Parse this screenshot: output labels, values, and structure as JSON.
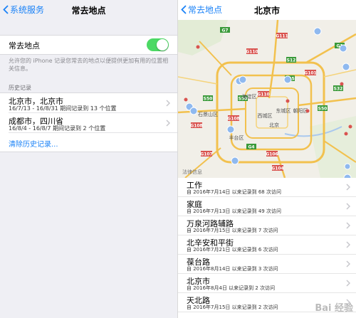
{
  "left": {
    "back_label": "系统服务",
    "title": "常去地点",
    "toggle": {
      "label": "常去地点",
      "on": true
    },
    "description": "允许您的 iPhone 记录您常去的地点以便提供更加有用的位置相关信息。",
    "history_header": "历史记录",
    "history": [
      {
        "title": "北京市，北京市",
        "subtitle": "16/7/13 - 16/8/31 期间记录到 13 个位置"
      },
      {
        "title": "成都市，四川省",
        "subtitle": "16/8/4 - 16/8/7 期间记录到 2 个位置"
      }
    ],
    "clear_label": "清除历史记录..."
  },
  "right": {
    "back_label": "常去地点",
    "title": "北京市",
    "map_labels": [
      "海淀区",
      "石景山区",
      "西城区",
      "东城区",
      "朝阳区",
      "北京",
      "丰台区"
    ],
    "map_legal": "法律信息",
    "places": [
      {
        "title": "工作",
        "subtitle": "自 2016年7月14日 以来记录到 68 次访问"
      },
      {
        "title": "家庭",
        "subtitle": "自 2016年7月13日 以来记录到 49 次访问"
      },
      {
        "title": "万泉河路辅路",
        "subtitle": "自 2016年7月15日 以来记录到 7 次访问"
      },
      {
        "title": "北辛安和平街",
        "subtitle": "自 2016年7月21日 以来记录到 6 次访问"
      },
      {
        "title": "葆台路",
        "subtitle": "自 2016年8月14日 以来记录到 3 次访问"
      },
      {
        "title": "北京市",
        "subtitle": "自 2016年8月4日 以来记录到 2 次访问"
      },
      {
        "title": "天北路",
        "subtitle": "自 2016年7月15日 以来记录到 2 次访问"
      }
    ],
    "watermark": "Bai 经验"
  },
  "colors": {
    "accent": "#1a82f7",
    "switch_on": "#4cd964",
    "pin": "#8fb9ef",
    "road_red": "#d9534f",
    "road_green": "#3a9a3a"
  }
}
